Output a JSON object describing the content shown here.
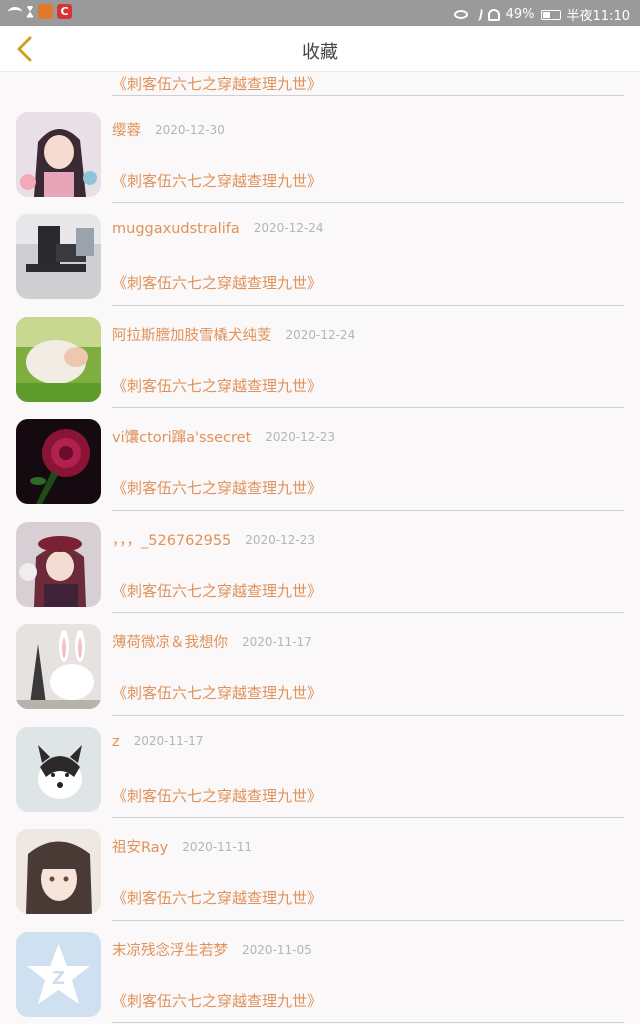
{
  "status_bar": {
    "battery": "49%",
    "battery_level": 0.49,
    "time": "半夜11:10",
    "app_badge_label": "C"
  },
  "header": {
    "title": "收藏",
    "back_icon": "chevron-left-icon",
    "back_color": "#c9a227"
  },
  "partial_top": {
    "work_title": "《刺客伍六七之穿越查理九世》"
  },
  "colors": {
    "accent": "#e0925a",
    "date": "#b5b5b5"
  },
  "favorites": [
    {
      "username": "缨蓉",
      "date": "2020-12-30",
      "work_title": "《刺客伍六七之穿越查理九世》",
      "avatar": "anime-girl-avatar"
    },
    {
      "username": "muggaxudstralifa",
      "date": "2020-12-24",
      "work_title": "《刺客伍六七之穿越查理九世》",
      "avatar": "couple-photo-avatar"
    },
    {
      "username": "阿拉斯膪加肢雪橇犬纯芰",
      "date": "2020-12-24",
      "work_title": "《刺客伍六七之穿越查理九世》",
      "avatar": "grass-photo-avatar"
    },
    {
      "username": "vi馕ctori蹿a'ssecret",
      "date": "2020-12-23",
      "work_title": "《刺客伍六七之穿越查理九世》",
      "avatar": "rose-avatar"
    },
    {
      "username": "，，，_526762955",
      "date": "2020-12-23",
      "work_title": "《刺客伍六七之穿越查理九世》",
      "avatar": "anime-hat-girl-avatar"
    },
    {
      "username": "薄荷微凉＆我想你",
      "date": "2020-11-17",
      "work_title": "《刺客伍六七之穿越查理九世》",
      "avatar": "bunny-paris-avatar"
    },
    {
      "username": "z",
      "date": "2020-11-17",
      "work_title": "《刺客伍六七之穿越查理九世》",
      "avatar": "husky-avatar"
    },
    {
      "username": "祖安Ray",
      "date": "2020-11-11",
      "work_title": "《刺客伍六七之穿越查理九世》",
      "avatar": "illustrated-girl-avatar"
    },
    {
      "username": "末凉残念浮生若梦",
      "date": "2020-11-05",
      "work_title": "《刺客伍六七之穿越查理九世》",
      "avatar": "qq-default-avatar"
    }
  ]
}
